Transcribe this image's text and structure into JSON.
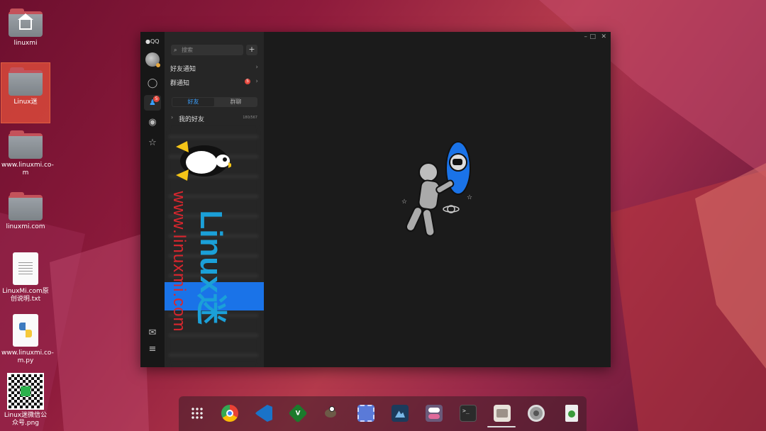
{
  "desktop": {
    "icons": [
      {
        "label": "linuxmi"
      },
      {
        "label": "Linux迷"
      },
      {
        "label": "www.linuxmi.co-m"
      },
      {
        "label": "linuxmi.com"
      },
      {
        "label": "LinuxMi.com原创说明.txt"
      },
      {
        "label": "www.linuxmi.co-m.py"
      },
      {
        "label": "Linux迷微信公众号.png"
      }
    ]
  },
  "qq": {
    "app_title": "QQ",
    "search_placeholder": "搜索",
    "plus_label": "+",
    "friend_notice": "好友通知",
    "group_notice": "群通知",
    "group_notice_badge": "5",
    "contacts_badge": "5",
    "tab_friends": "好友",
    "tab_groups": "群聊",
    "group_name": "我的好友",
    "group_count": "180/567"
  },
  "watermark": {
    "text_url": "www.linuxmi.com",
    "text_brand": "Linux迷"
  },
  "colors": {
    "accent": "#3aa0ff",
    "badge": "#e5483d",
    "watermark_blue": "#1a73e8",
    "watermark_red": "#d8262e"
  },
  "dock": {
    "apps": [
      "apps-grid-icon",
      "chrome-icon",
      "vscode-icon",
      "vim-icon",
      "gimp-icon",
      "screenshot-icon",
      "image-viewer-icon",
      "tweaks-icon",
      "terminal-icon",
      "files-icon",
      "settings-icon",
      "trash-icon"
    ]
  }
}
